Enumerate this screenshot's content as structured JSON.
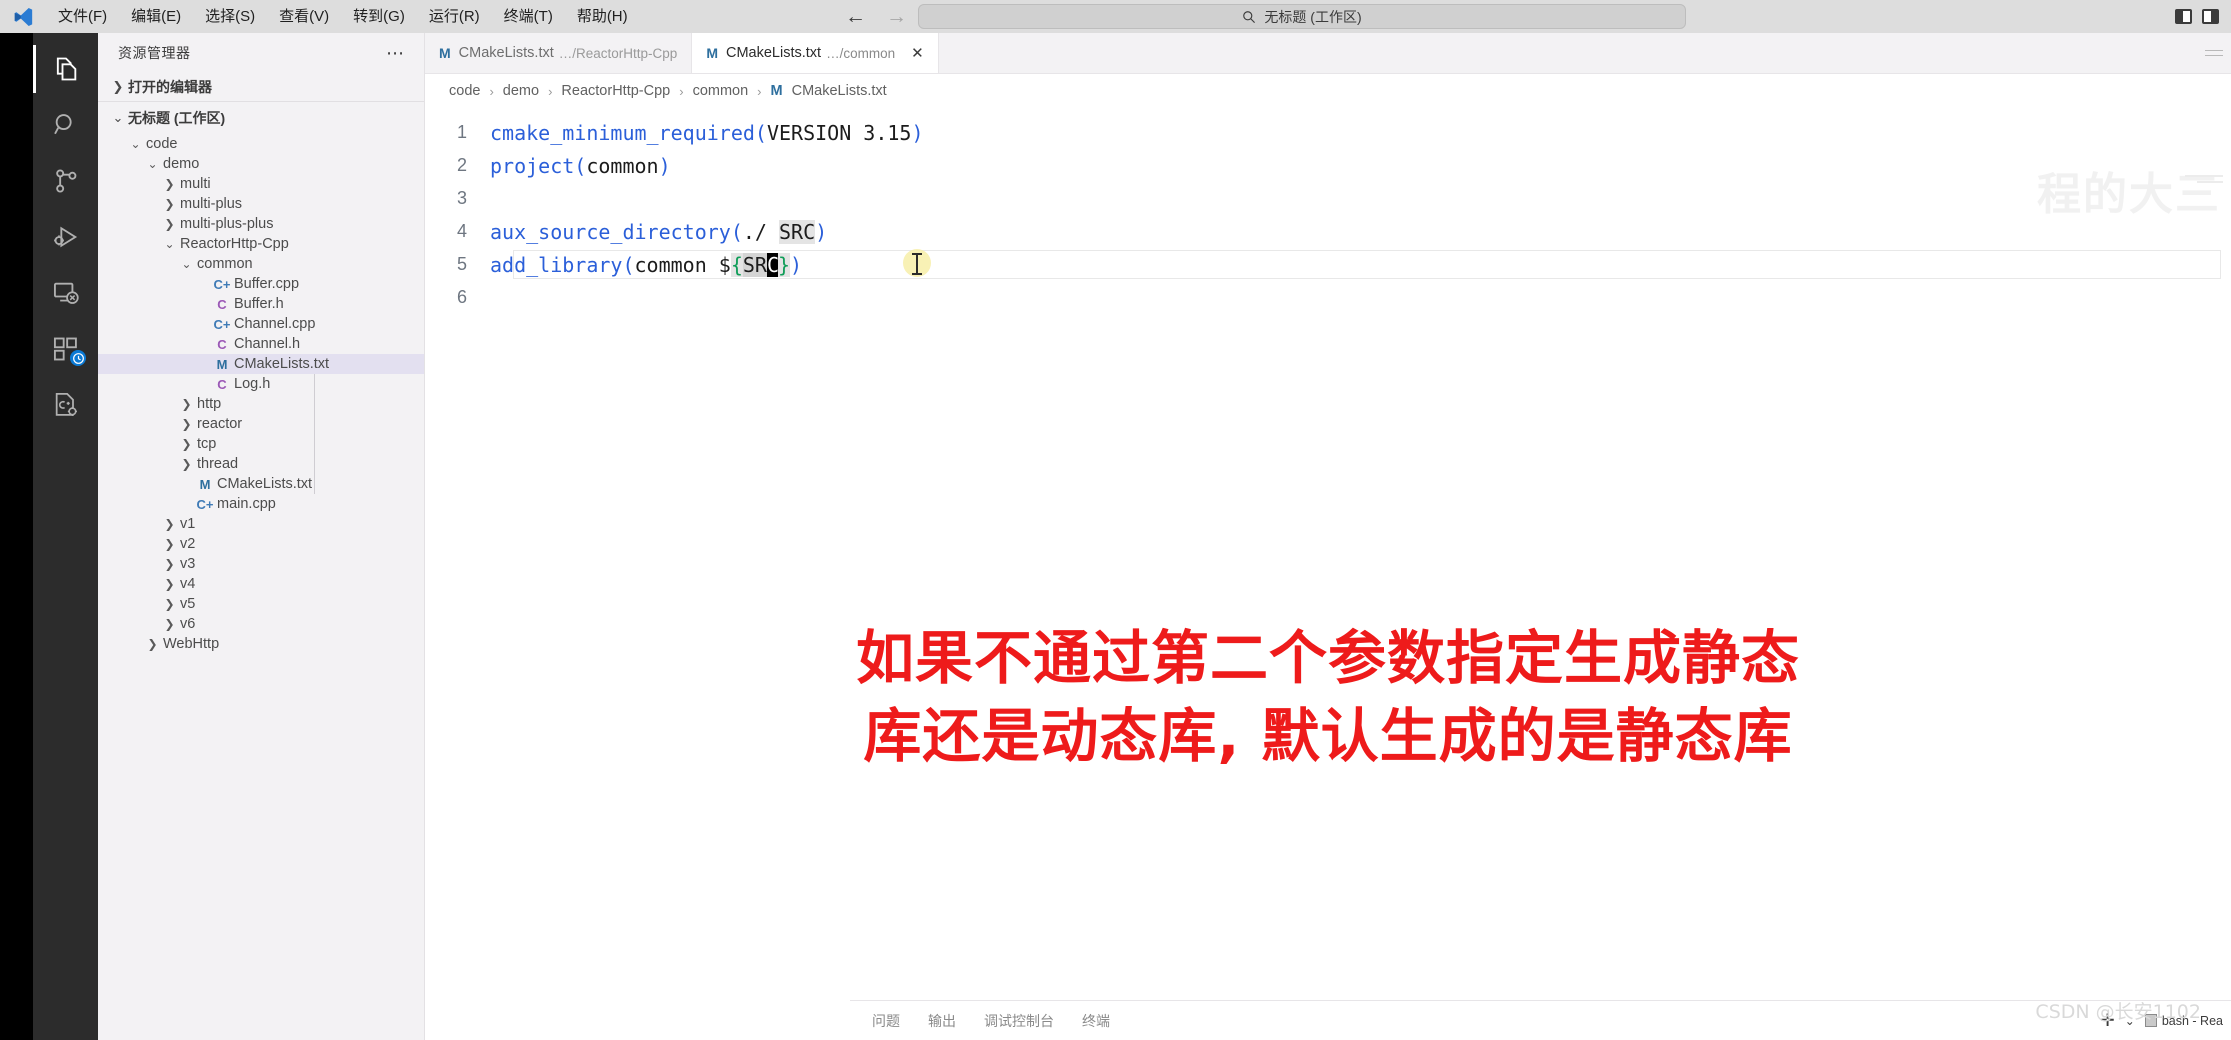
{
  "titlebar": {
    "logo_icon": "vscode-logo-icon",
    "menus": [
      {
        "label": "文件(F)"
      },
      {
        "label": "编辑(E)"
      },
      {
        "label": "选择(S)"
      },
      {
        "label": "查看(V)"
      },
      {
        "label": "转到(G)"
      },
      {
        "label": "运行(R)"
      },
      {
        "label": "终端(T)"
      },
      {
        "label": "帮助(H)"
      }
    ],
    "nav": {
      "back": "←",
      "forward": "→"
    },
    "quick_input": {
      "search_icon": "search-icon",
      "value": "无标题 (工作区)"
    },
    "window_controls": [
      {
        "name": "toggle-primary-sidebar",
        "icon": "layout-sidebar-left-icon"
      },
      {
        "name": "toggle-panel",
        "icon": "layout-panel-icon"
      }
    ]
  },
  "activitybar": {
    "items": [
      {
        "name": "explorer",
        "icon": "files-icon",
        "active": true,
        "badge": ""
      },
      {
        "name": "search",
        "icon": "search-icon",
        "active": false,
        "badge": ""
      },
      {
        "name": "source-control",
        "icon": "source-control-icon",
        "active": false,
        "badge": ""
      },
      {
        "name": "run-and-debug",
        "icon": "run-debug-icon",
        "active": false,
        "badge": ""
      },
      {
        "name": "remote-explorer",
        "icon": "remote-explorer-icon",
        "active": false,
        "badge": ""
      },
      {
        "name": "extensions",
        "icon": "extensions-icon",
        "active": false,
        "badge": "clock"
      },
      {
        "name": "cpp-config",
        "icon": "cpp-config-icon",
        "active": false,
        "badge": ""
      }
    ]
  },
  "sidebar": {
    "title": "资源管理器",
    "more_actions_icon": "ellipsis-icon",
    "open_editors": {
      "label": "打开的编辑器",
      "expanded": false,
      "chevron": "chevron-right-icon"
    },
    "workspace": {
      "label": "无标题 (工作区)",
      "expanded": true,
      "chevron": "chevron-down-icon"
    },
    "tree": [
      {
        "label": "code",
        "type": "folder",
        "depth": 1,
        "expanded": true,
        "selected": false
      },
      {
        "label": "demo",
        "type": "folder",
        "depth": 2,
        "expanded": true,
        "selected": false
      },
      {
        "label": "multi",
        "type": "folder",
        "depth": 3,
        "expanded": false,
        "selected": false
      },
      {
        "label": "multi-plus",
        "type": "folder",
        "depth": 3,
        "expanded": false,
        "selected": false
      },
      {
        "label": "multi-plus-plus",
        "type": "folder",
        "depth": 3,
        "expanded": false,
        "selected": false
      },
      {
        "label": "ReactorHttp-Cpp",
        "type": "folder",
        "depth": 3,
        "expanded": true,
        "selected": false
      },
      {
        "label": "common",
        "type": "folder",
        "depth": 4,
        "expanded": true,
        "selected": false
      },
      {
        "label": "Buffer.cpp",
        "type": "file",
        "icon": "cpp",
        "glyph": "C+",
        "depth": 5,
        "selected": false
      },
      {
        "label": "Buffer.h",
        "type": "file",
        "icon": "h",
        "glyph": "C",
        "depth": 5,
        "selected": false
      },
      {
        "label": "Channel.cpp",
        "type": "file",
        "icon": "cpp",
        "glyph": "C+",
        "depth": 5,
        "selected": false
      },
      {
        "label": "Channel.h",
        "type": "file",
        "icon": "h",
        "glyph": "C",
        "depth": 5,
        "selected": false
      },
      {
        "label": "CMakeLists.txt",
        "type": "file",
        "icon": "m",
        "glyph": "M",
        "depth": 5,
        "selected": true
      },
      {
        "label": "Log.h",
        "type": "file",
        "icon": "h",
        "glyph": "C",
        "depth": 5,
        "selected": false
      },
      {
        "label": "http",
        "type": "folder",
        "depth": 4,
        "expanded": false,
        "selected": false
      },
      {
        "label": "reactor",
        "type": "folder",
        "depth": 4,
        "expanded": false,
        "selected": false
      },
      {
        "label": "tcp",
        "type": "folder",
        "depth": 4,
        "expanded": false,
        "selected": false
      },
      {
        "label": "thread",
        "type": "folder",
        "depth": 4,
        "expanded": false,
        "selected": false
      },
      {
        "label": "CMakeLists.txt",
        "type": "file",
        "icon": "m",
        "glyph": "M",
        "depth": 4,
        "selected": false
      },
      {
        "label": "main.cpp",
        "type": "file",
        "icon": "cpp",
        "glyph": "C+",
        "depth": 4,
        "selected": false
      },
      {
        "label": "v1",
        "type": "folder",
        "depth": 3,
        "expanded": false,
        "selected": false
      },
      {
        "label": "v2",
        "type": "folder",
        "depth": 3,
        "expanded": false,
        "selected": false
      },
      {
        "label": "v3",
        "type": "folder",
        "depth": 3,
        "expanded": false,
        "selected": false
      },
      {
        "label": "v4",
        "type": "folder",
        "depth": 3,
        "expanded": false,
        "selected": false
      },
      {
        "label": "v5",
        "type": "folder",
        "depth": 3,
        "expanded": false,
        "selected": false
      },
      {
        "label": "v6",
        "type": "folder",
        "depth": 3,
        "expanded": false,
        "selected": false
      },
      {
        "label": "WebHttp",
        "type": "folder",
        "depth": 2,
        "expanded": false,
        "selected": false
      }
    ]
  },
  "editor": {
    "tabs": [
      {
        "glyph": "M",
        "name": "CMakeLists.txt",
        "path": "…/ReactorHttp-Cpp",
        "active": false,
        "closable": false
      },
      {
        "glyph": "M",
        "name": "CMakeLists.txt",
        "path": "…/common",
        "active": true,
        "closable": true,
        "close_icon": "close-icon"
      }
    ],
    "breadcrumb": [
      {
        "label": "code"
      },
      {
        "label": "demo"
      },
      {
        "label": "ReactorHttp-Cpp"
      },
      {
        "label": "common"
      },
      {
        "label": "CMakeLists.txt",
        "glyph": "M"
      }
    ],
    "breadcrumb_separator": "›",
    "lines": [
      {
        "num": "1",
        "text": "cmake_minimum_required(VERSION 3.15)"
      },
      {
        "num": "2",
        "text": "project(common)"
      },
      {
        "num": "3",
        "text": ""
      },
      {
        "num": "4",
        "text": "aux_source_directory(./ SRC)"
      },
      {
        "num": "5",
        "text": "add_library(common ${SRC})"
      },
      {
        "num": "6",
        "text": ""
      }
    ],
    "current_line": "5",
    "selection_word": "SRC",
    "annotation": {
      "line1": "如果不通过第二个参数指定生成静态",
      "line2": "库还是动态库, 默认生成的是静态库",
      "color": "#ee1b1b"
    },
    "faint_watermark": "程的大三"
  },
  "panel": {
    "tabs": [
      {
        "label": "问题"
      },
      {
        "label": "输出"
      },
      {
        "label": "调试控制台"
      },
      {
        "label": "终端"
      }
    ],
    "new_terminal_icon": "plus-icon",
    "dropdown_icon": "chevron-down-icon",
    "terminal_label": "bash - Rea"
  },
  "watermark": {
    "text": "CSDN @长安1102"
  }
}
